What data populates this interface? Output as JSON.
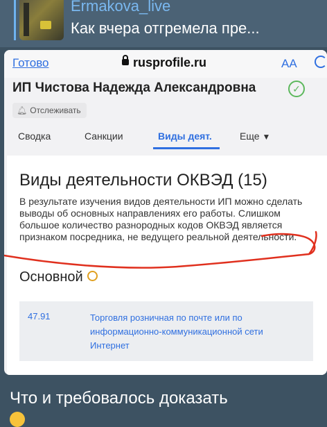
{
  "reply": {
    "author": "Ermakova_live",
    "text": "Как вчера отгремела пре..."
  },
  "browser": {
    "done_label": "Готово",
    "url": "rusprofile.ru",
    "text_size_label": "AA"
  },
  "company": {
    "name": "ИП Чистова Надежда Александровна",
    "track_label": "Отслеживать"
  },
  "tabs": [
    {
      "label": "Сводка"
    },
    {
      "label": "Санкции"
    },
    {
      "label": "Виды деят."
    },
    {
      "label": "Еще"
    }
  ],
  "card": {
    "title": "Виды деятельности ОКВЭД (15)",
    "description": "В результате изучения видов деятельности ИП можно сделать выводы об основных направлениях его работы. Слишком большое количество разнородных кодов ОКВЭД является признаком посредника, не ведущего реальной деятельности.",
    "section_title": "Основной",
    "okved_code": "47.91",
    "okved_name": "Торговля розничная по почте или по информационно-коммуникационной сети Интернет"
  },
  "caption": "Что и требовалось доказать",
  "colors": {
    "accent": "#2f6fe0",
    "annotation": "#e0301e",
    "chat_bg": "#3d5262"
  }
}
